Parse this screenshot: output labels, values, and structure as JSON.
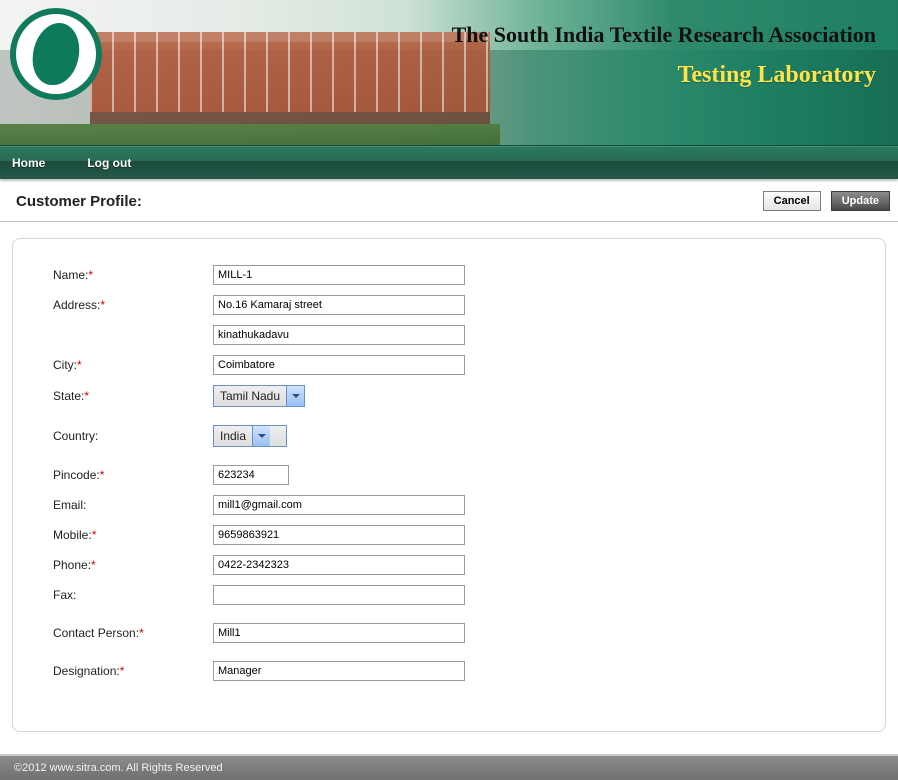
{
  "header": {
    "org": "The South India Textile Research Association",
    "sub": "Testing Laboratory"
  },
  "nav": {
    "home": "Home",
    "logout": "Log out"
  },
  "page": {
    "title": "Customer Profile:",
    "cancel": "Cancel",
    "update": "Update"
  },
  "form": {
    "labels": {
      "name": "Name:",
      "address": "Address:",
      "city": "City:",
      "state": "State:",
      "country": "Country:",
      "pincode": "Pincode:",
      "email": "Email:",
      "mobile": "Mobile:",
      "phone": "Phone:",
      "fax": "Fax:",
      "contact": "Contact Person:",
      "designation": "Designation:"
    },
    "values": {
      "name": "MILL-1",
      "address1": "No.16 Kamaraj street",
      "address2": "kinathukadavu",
      "city": "Coimbatore",
      "state": "Tamil Nadu",
      "country": "India",
      "pincode": "623234",
      "email": "mill1@gmail.com",
      "mobile": "9659863921",
      "phone": "0422-2342323",
      "fax": "",
      "contact": "Mill1",
      "designation": "Manager"
    }
  },
  "footer": "©2012 www.sitra.com. All Rights Reserved"
}
